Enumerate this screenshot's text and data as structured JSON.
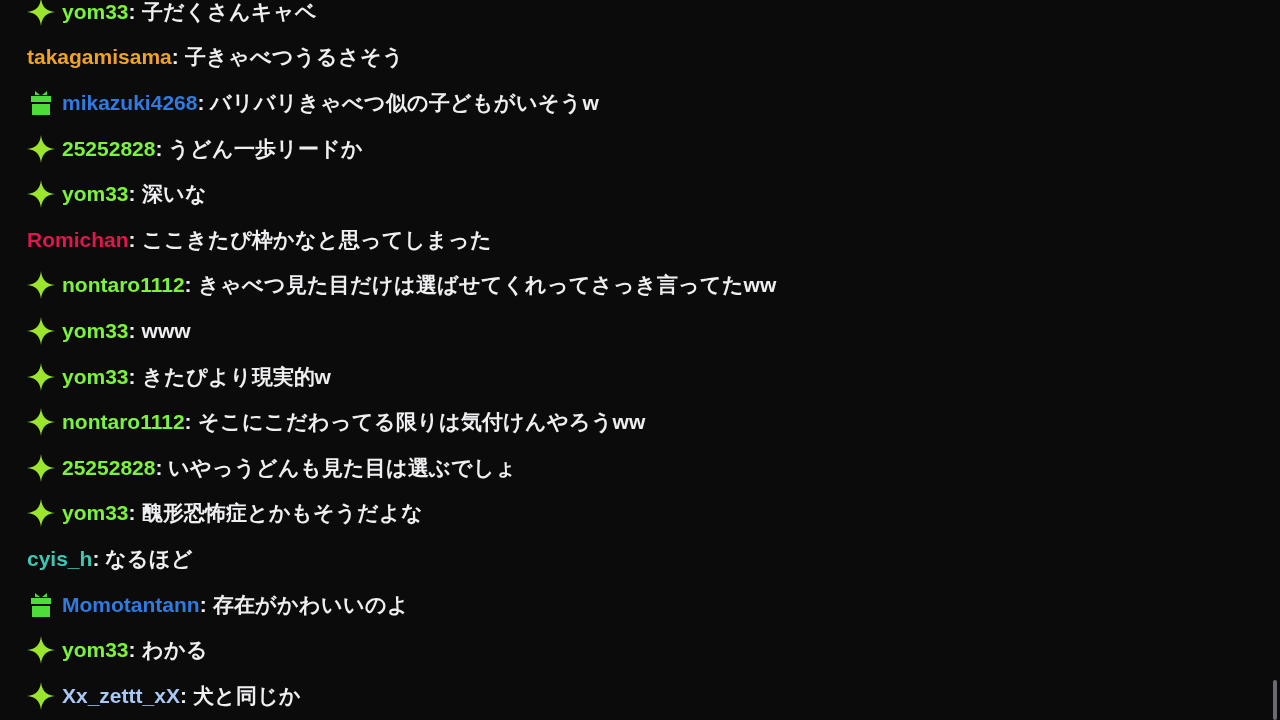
{
  "chat": {
    "messages": [
      {
        "kind": "sparkle",
        "user": "yom33",
        "color": "#7cf23c",
        "colon": ":",
        "text": "子だくさんキャベ"
      },
      {
        "kind": "plain",
        "user": "takagamisama",
        "color": "#f0a225",
        "colon": ":",
        "text": "子きゃべつうるさそう"
      },
      {
        "kind": "gift",
        "user": "mikazuki4268",
        "color": "#2f7be0",
        "colon": ":",
        "text": "バリバリきゃべつ似の子どもがいそうw"
      },
      {
        "kind": "sparkle",
        "user": "25252828",
        "color": "#7cf23c",
        "colon": ":",
        "text": "うどん一歩リードか"
      },
      {
        "kind": "sparkle",
        "user": "yom33",
        "color": "#7cf23c",
        "colon": ":",
        "text": "深いな"
      },
      {
        "kind": "plain",
        "user": "Romichan",
        "color": "#e0164c",
        "colon": ":",
        "text": "ここきたぴ枠かなと思ってしまった"
      },
      {
        "kind": "sparkle",
        "user": "nontaro1112",
        "color": "#7cf23c",
        "colon": ":",
        "text": "きゃべつ見た目だけは選ばせてくれってさっき言ってたww"
      },
      {
        "kind": "sparkle",
        "user": "yom33",
        "color": "#7cf23c",
        "colon": ":",
        "text": "www"
      },
      {
        "kind": "sparkle",
        "user": "yom33",
        "color": "#7cf23c",
        "colon": ":",
        "text": "きたぴより現実的w"
      },
      {
        "kind": "sparkle",
        "user": "nontaro1112",
        "color": "#7cf23c",
        "colon": ":",
        "text": "そこにこだわってる限りは気付けんやろうww"
      },
      {
        "kind": "sparkle",
        "user": "25252828",
        "color": "#7cf23c",
        "colon": ":",
        "text": "いやっうどんも見た目は選ぶでしょ"
      },
      {
        "kind": "sparkle",
        "user": "yom33",
        "color": "#7cf23c",
        "colon": ":",
        "text": "醜形恐怖症とかもそうだよな"
      },
      {
        "kind": "plain",
        "user": "cyis_h",
        "color": "#3cc8b4",
        "colon": ":",
        "text": "なるほど"
      },
      {
        "kind": "gift",
        "user": "Momotantann",
        "color": "#2f7be0",
        "colon": ":",
        "text": "存在がかわいいのよ"
      },
      {
        "kind": "sparkle",
        "user": "yom33",
        "color": "#7cf23c",
        "colon": ":",
        "text": "わかる"
      },
      {
        "kind": "sparkle",
        "user": "Xx_zettt_xX",
        "color": "#a9c8f5",
        "colon": ":",
        "text": "犬と同じか"
      }
    ]
  }
}
